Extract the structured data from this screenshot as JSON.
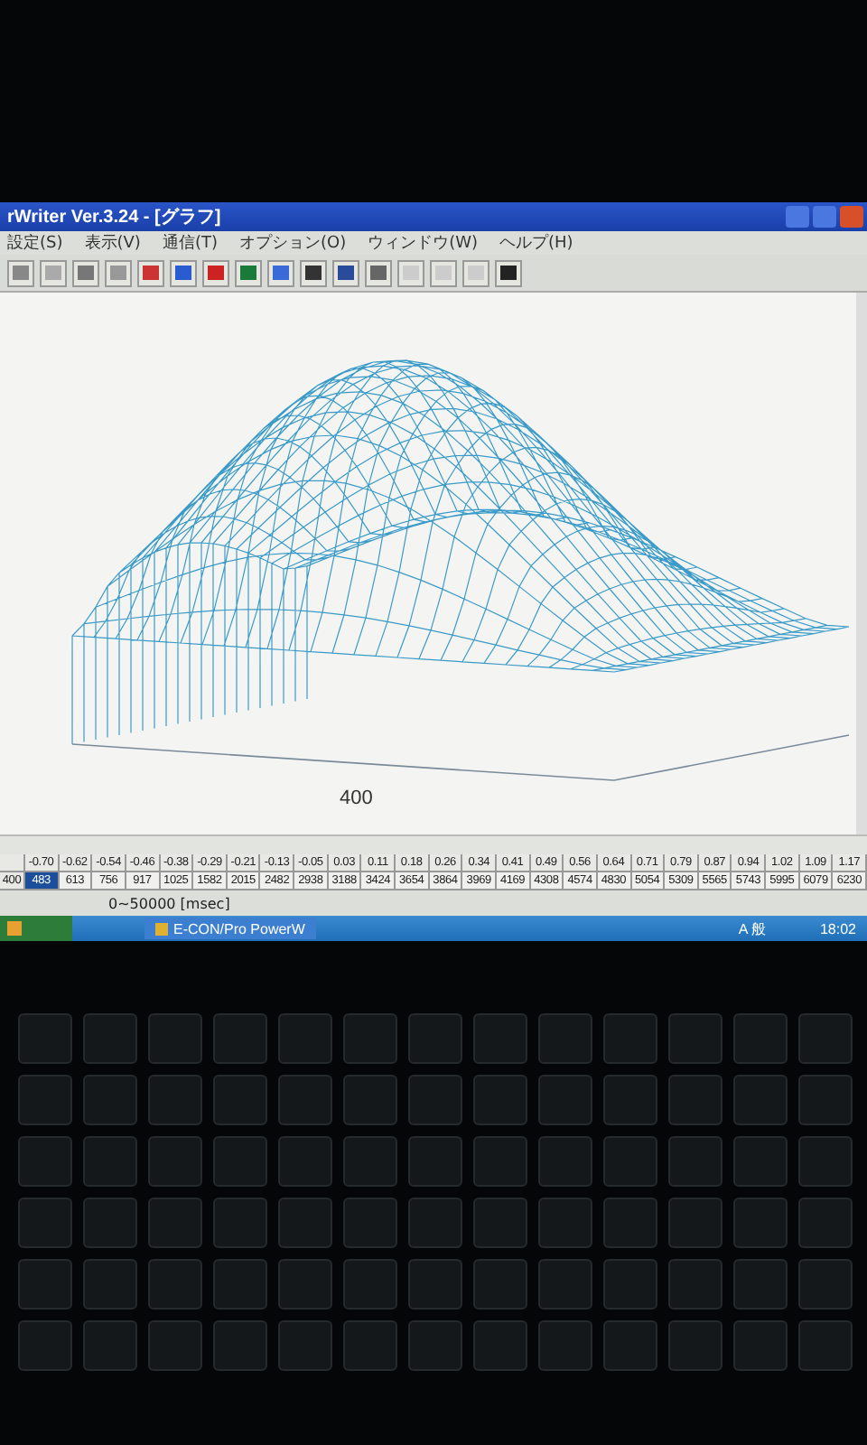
{
  "window": {
    "title": "rWriter Ver.3.24 - [グラフ]"
  },
  "menu": [
    "設定(S)",
    "表示(V)",
    "通信(T)",
    "オプション(O)",
    "ウィンドウ(W)",
    "ヘルプ(H)"
  ],
  "graph": {
    "axis_label": "400"
  },
  "table": {
    "header": [
      "-0.70",
      "-0.62",
      "-0.54",
      "-0.46",
      "-0.38",
      "-0.29",
      "-0.21",
      "-0.13",
      "-0.05",
      "0.03",
      "0.11",
      "0.18",
      "0.26",
      "0.34",
      "0.41",
      "0.49",
      "0.56",
      "0.64",
      "0.71",
      "0.79",
      "0.87",
      "0.94",
      "1.02",
      "1.09",
      "1.17"
    ],
    "row_label": "400",
    "cells": [
      {
        "text": "483",
        "selected": true
      },
      {
        "text": "613",
        "selected": false
      },
      {
        "text": "756",
        "selected": false
      },
      {
        "text": "917",
        "selected": false
      },
      {
        "text": "1025",
        "selected": false
      },
      {
        "text": "1582",
        "selected": false
      },
      {
        "text": "2015",
        "selected": false
      },
      {
        "text": "2482",
        "selected": false
      },
      {
        "text": "2938",
        "selected": false
      },
      {
        "text": "3188",
        "selected": false
      },
      {
        "text": "3424",
        "selected": false
      },
      {
        "text": "3654",
        "selected": false
      },
      {
        "text": "3864",
        "selected": false
      },
      {
        "text": "3969",
        "selected": false
      },
      {
        "text": "4169",
        "selected": false
      },
      {
        "text": "4308",
        "selected": false
      },
      {
        "text": "4574",
        "selected": false
      },
      {
        "text": "4830",
        "selected": false
      },
      {
        "text": "5054",
        "selected": false
      },
      {
        "text": "5309",
        "selected": false
      },
      {
        "text": "5565",
        "selected": false
      },
      {
        "text": "5743",
        "selected": false
      },
      {
        "text": "5995",
        "selected": false
      },
      {
        "text": "6079",
        "selected": false
      },
      {
        "text": "6230",
        "selected": false
      }
    ]
  },
  "status_bar": [
    "0~50000 [msec]"
  ],
  "taskbar": {
    "task": "E-CON/Pro PowerW",
    "ime": "A 般",
    "clock": "18:02"
  }
}
